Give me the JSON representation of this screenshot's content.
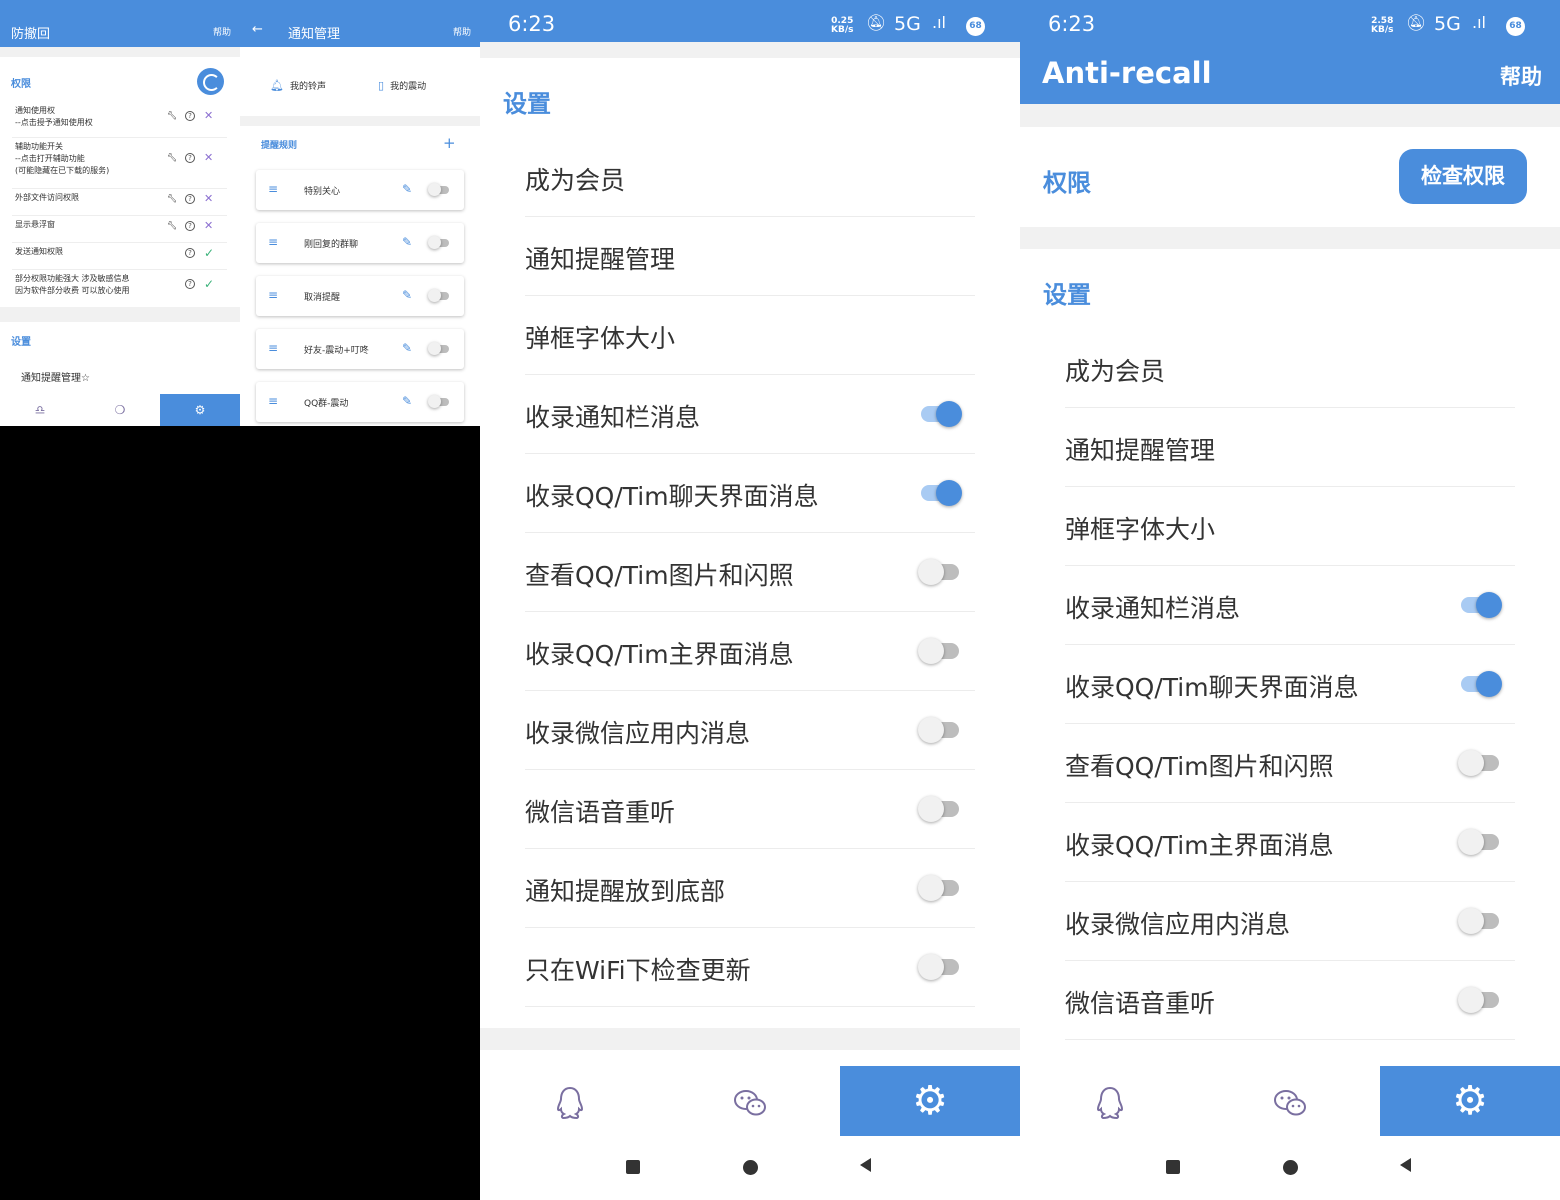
{
  "colors": {
    "primary": "#4a8ddc",
    "toggle_track_on": "#a9cbf3",
    "toggle_off_knob": "#f1f1f1",
    "toggle_off_track": "#bdbdbd",
    "ok": "#3bb27a",
    "deny": "#8b6fd0"
  },
  "panel1": {
    "app_title": "防撤回",
    "help": "帮助",
    "permissions_title": "权限",
    "permissions": [
      {
        "lines": [
          "通知使用权",
          "--点击授予通知使用权"
        ],
        "icons": [
          "wrench-icon",
          "help-icon",
          "cross-icon"
        ]
      },
      {
        "lines": [
          "辅助功能开关",
          "--点击打开辅助功能",
          "(可能隐藏在已下载的服务)"
        ],
        "icons": [
          "wrench-icon",
          "help-icon",
          "cross-icon"
        ]
      },
      {
        "lines": [
          "外部文件访问权限"
        ],
        "icons": [
          "wrench-icon",
          "help-icon",
          "cross-icon"
        ]
      },
      {
        "lines": [
          "显示悬浮窗"
        ],
        "icons": [
          "wrench-icon",
          "help-icon",
          "cross-icon"
        ]
      },
      {
        "lines": [
          "发送通知权限"
        ],
        "icons": [
          "help-icon",
          "check-icon"
        ]
      },
      {
        "lines": [
          "部分权限功能强大 涉及敏感信息",
          "因为软件部分收费 可以放心使用"
        ],
        "icons": [
          "help-icon",
          "check-icon"
        ]
      }
    ],
    "settings_title": "设置",
    "settings_first_item": "通知提醒管理☆",
    "nav": [
      "qq-tab",
      "wechat-tab",
      "settings-tab"
    ]
  },
  "panel2": {
    "title": "通知管理",
    "help": "帮助",
    "ringtone": "我的铃声",
    "vibration": "我的震动",
    "rules_title": "提醒规则",
    "rules": [
      {
        "name": "特别关心",
        "enabled": false
      },
      {
        "name": "刚回复的群聊",
        "enabled": false
      },
      {
        "name": "取消提醒",
        "enabled": false
      },
      {
        "name": "好友-震动+叮咚",
        "enabled": false
      },
      {
        "name": "QQ群-震动",
        "enabled": false
      }
    ]
  },
  "panel3": {
    "status": {
      "time": "6:23",
      "speed_value": "0.25",
      "speed_unit": "KB/s",
      "network": "5G",
      "battery": "68"
    },
    "settings_title": "设置",
    "settings": [
      {
        "label": "成为会员",
        "toggle": null
      },
      {
        "label": "通知提醒管理",
        "toggle": null
      },
      {
        "label": "弹框字体大小",
        "toggle": null
      },
      {
        "label": "收录通知栏消息",
        "toggle": true
      },
      {
        "label": "收录QQ/Tim聊天界面消息",
        "toggle": true
      },
      {
        "label": "查看QQ/Tim图片和闪照",
        "toggle": false
      },
      {
        "label": "收录QQ/Tim主界面消息",
        "toggle": false
      },
      {
        "label": "收录微信应用内消息",
        "toggle": false
      },
      {
        "label": "微信语音重听",
        "toggle": false
      },
      {
        "label": "通知提醒放到底部",
        "toggle": false
      },
      {
        "label": "只在WiFi下检查更新",
        "toggle": false
      }
    ]
  },
  "panel4": {
    "status": {
      "time": "6:23",
      "speed_value": "2.58",
      "speed_unit": "KB/s",
      "network": "5G",
      "battery": "68"
    },
    "app_title": "Anti-recall",
    "help": "帮助",
    "permissions_title": "权限",
    "check_permissions": "检查权限",
    "settings_title": "设置",
    "settings": [
      {
        "label": "成为会员",
        "toggle": null
      },
      {
        "label": "通知提醒管理",
        "toggle": null
      },
      {
        "label": "弹框字体大小",
        "toggle": null
      },
      {
        "label": "收录通知栏消息",
        "toggle": true
      },
      {
        "label": "收录QQ/Tim聊天界面消息",
        "toggle": true
      },
      {
        "label": "查看QQ/Tim图片和闪照",
        "toggle": false
      },
      {
        "label": "收录QQ/Tim主界面消息",
        "toggle": false
      },
      {
        "label": "收录微信应用内消息",
        "toggle": false
      },
      {
        "label": "微信语音重听",
        "toggle": false
      }
    ]
  }
}
